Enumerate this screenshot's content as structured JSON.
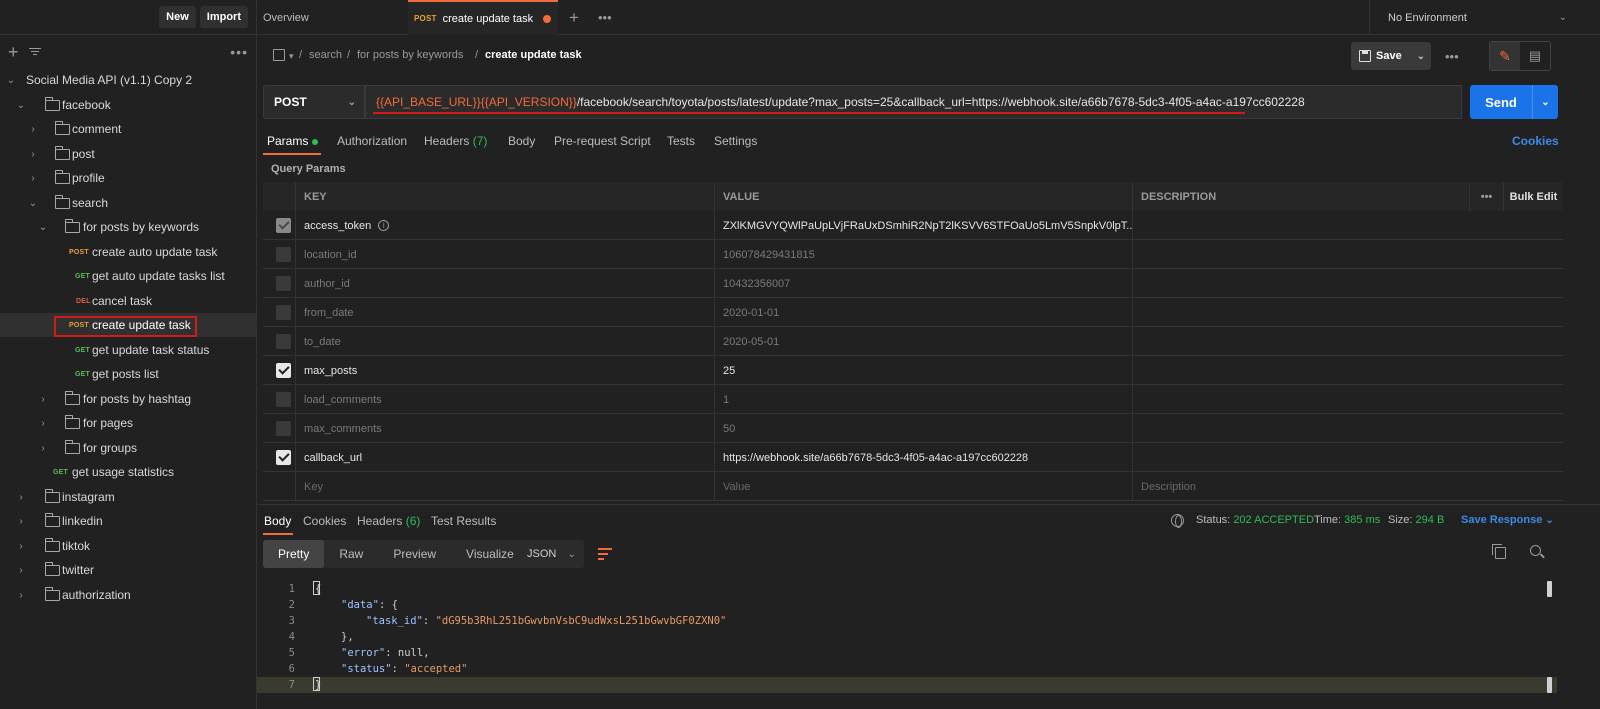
{
  "sidebar": {
    "new_label": "New",
    "import_label": "Import",
    "more": "•••",
    "tree": [
      {
        "label": "Social Media API (v1.1) Copy 2",
        "type": "collection",
        "expanded": true
      },
      {
        "label": "facebook",
        "type": "folder",
        "expanded": true
      },
      {
        "label": "comment",
        "type": "folder",
        "expanded": false
      },
      {
        "label": "post",
        "type": "folder",
        "expanded": false
      },
      {
        "label": "profile",
        "type": "folder",
        "expanded": false
      },
      {
        "label": "search",
        "type": "folder",
        "expanded": true
      },
      {
        "label": "for posts by keywords",
        "type": "folder",
        "expanded": true
      },
      {
        "label": "create auto update task",
        "type": "request",
        "method": "POST"
      },
      {
        "label": "get auto update tasks list",
        "type": "request",
        "method": "GET"
      },
      {
        "label": "cancel task",
        "type": "request",
        "method": "DEL"
      },
      {
        "label": "create update task",
        "type": "request",
        "method": "POST",
        "active": true
      },
      {
        "label": "get update task status",
        "type": "request",
        "method": "GET"
      },
      {
        "label": "get posts list",
        "type": "request",
        "method": "GET"
      },
      {
        "label": "for posts by hashtag",
        "type": "folder",
        "expanded": false
      },
      {
        "label": "for pages",
        "type": "folder",
        "expanded": false
      },
      {
        "label": "for groups",
        "type": "folder",
        "expanded": false
      },
      {
        "label": "get usage statistics",
        "type": "request",
        "method": "GET"
      },
      {
        "label": "instagram",
        "type": "folder",
        "expanded": false
      },
      {
        "label": "linkedin",
        "type": "folder",
        "expanded": false
      },
      {
        "label": "tiktok",
        "type": "folder",
        "expanded": false
      },
      {
        "label": "twitter",
        "type": "folder",
        "expanded": false
      },
      {
        "label": "authorization",
        "type": "folder",
        "expanded": false
      }
    ]
  },
  "tabs": {
    "overview": "Overview",
    "active_method": "POST",
    "active_label": "create update task",
    "plus": "+",
    "more": "•••",
    "environment": "No Environment"
  },
  "breadcrumb": {
    "sep": "/",
    "items": [
      "search",
      "for posts by keywords"
    ],
    "current": "create update task"
  },
  "toolbar": {
    "save_label": "Save",
    "more": "•••"
  },
  "request": {
    "method": "POST",
    "url_var1": "{{API_BASE_URL}}",
    "url_var2": "{{API_VERSION}}",
    "url_rest": "/facebook/search/toyota/posts/latest/update?max_posts=25&callback_url=https://webhook.site/a66b7678-5dc3-4f05-a4ac-a197cc602228",
    "send_label": "Send"
  },
  "request_tabs": {
    "params": "Params",
    "authorization": "Authorization",
    "headers": "Headers",
    "headers_count": "(7)",
    "body": "Body",
    "prerequest": "Pre-request Script",
    "tests": "Tests",
    "settings": "Settings",
    "cookies": "Cookies"
  },
  "params": {
    "title": "Query Params",
    "headers": {
      "key": "KEY",
      "value": "VALUE",
      "description": "DESCRIPTION",
      "more": "•••",
      "bulk": "Bulk Edit"
    },
    "rows": [
      {
        "key": "access_token",
        "value": "ZXlKMGVYQWlPaUpLVjFRaUxDSmhiR2NpT2lKSVV6STFOaUo5LmV5SnpkV0lpT...",
        "checked": true
      },
      {
        "key": "location_id",
        "value": "106078429431815",
        "checked": false
      },
      {
        "key": "author_id",
        "value": "10432356007",
        "checked": false
      },
      {
        "key": "from_date",
        "value": "2020-01-01",
        "checked": false
      },
      {
        "key": "to_date",
        "value": "2020-05-01",
        "checked": false
      },
      {
        "key": "max_posts",
        "value": "25",
        "checked": true
      },
      {
        "key": "load_comments",
        "value": "1",
        "checked": false
      },
      {
        "key": "max_comments",
        "value": "50",
        "checked": false
      },
      {
        "key": "callback_url",
        "value": "https://webhook.site/a66b7678-5dc3-4f05-a4ac-a197cc602228",
        "checked": true
      }
    ],
    "placeholders": {
      "key": "Key",
      "value": "Value",
      "description": "Description"
    }
  },
  "response": {
    "tabs": {
      "body": "Body",
      "cookies": "Cookies",
      "headers": "Headers",
      "headers_count": "(6)",
      "test_results": "Test Results"
    },
    "status_label": "Status:",
    "status_value": "202 ACCEPTED",
    "time_label": "Time:",
    "time_value": "385 ms",
    "size_label": "Size:",
    "size_value": "294 B",
    "save_response": "Save Response",
    "formats": [
      "Pretty",
      "Raw",
      "Preview",
      "Visualize"
    ],
    "json_label": "JSON",
    "code": {
      "l1": "{",
      "l2_key": "\"data\"",
      "l2_rest": ": {",
      "l3_key": "\"task_id\"",
      "l3_val": "\"dG95b3RhL251bGwvbnVsbC9udWxsL251bGwvbGF0ZXN0\"",
      "l4": "},",
      "l5_key": "\"error\"",
      "l5_rest": ": null,",
      "l6_key": "\"status\"",
      "l6_val": "\"accepted\"",
      "l7": "}"
    }
  },
  "colors": {
    "accent": "#f26b3a",
    "send": "#1a73e8",
    "status_green": "#2ebd59",
    "link_blue": "#3d8ae5",
    "highlight_red": "#d31b1b"
  }
}
